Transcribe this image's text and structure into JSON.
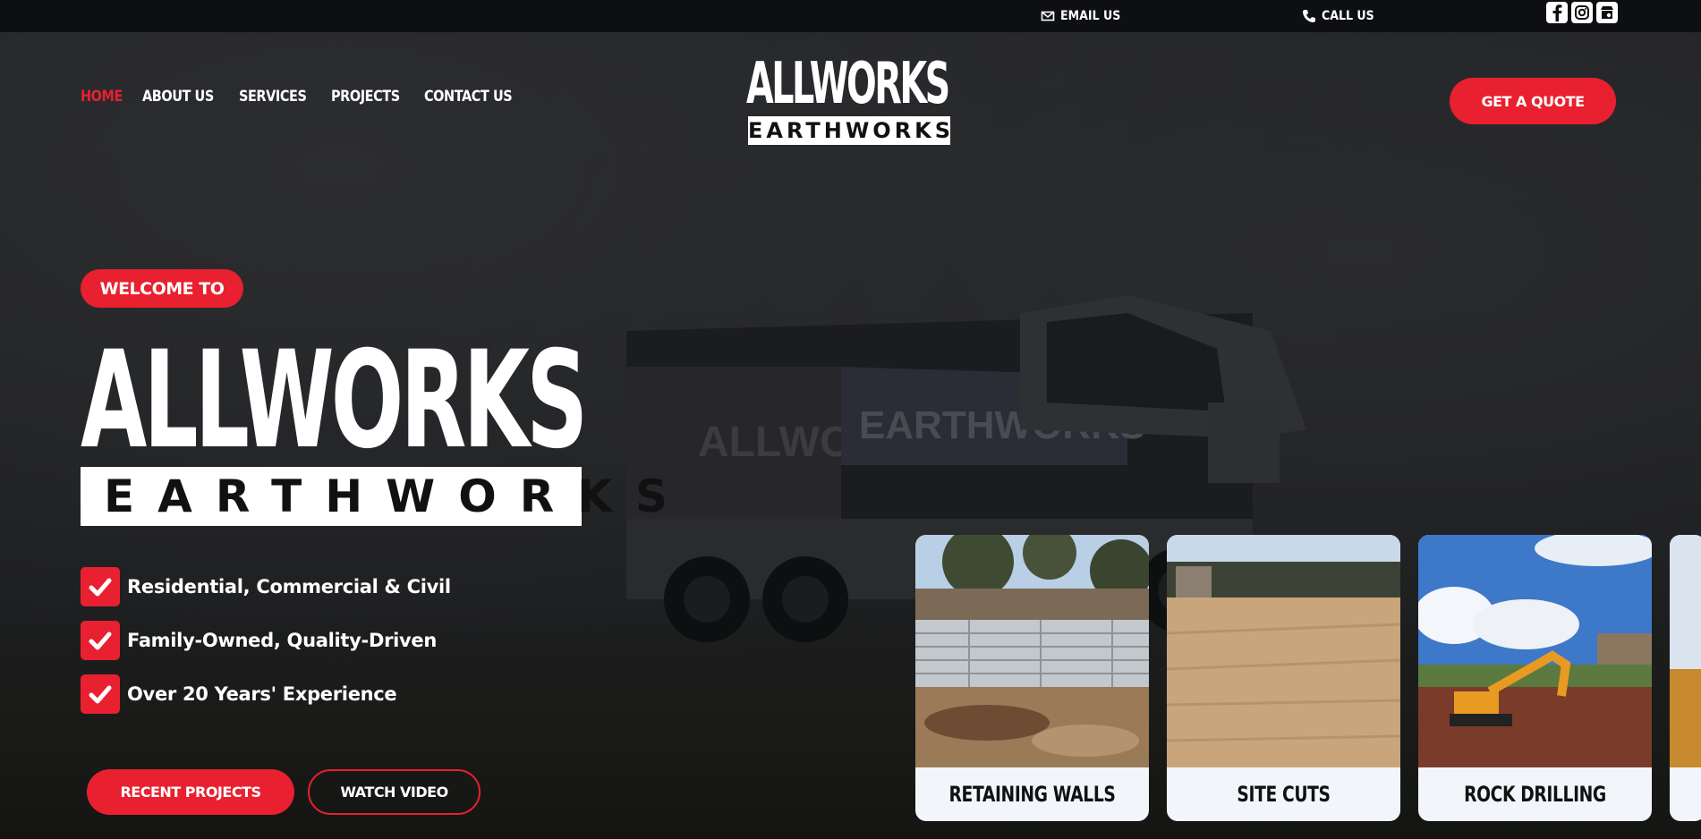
{
  "topbar": {
    "email_label": "EMAIL US",
    "call_label": "CALL US",
    "social": [
      "facebook-icon",
      "instagram-icon",
      "google-business-icon"
    ]
  },
  "nav": {
    "items": [
      {
        "label": "HOME",
        "active": true
      },
      {
        "label": "ABOUT US",
        "active": false
      },
      {
        "label": "SERVICES",
        "active": false
      },
      {
        "label": "PROJECTS",
        "active": false
      },
      {
        "label": "CONTACT US",
        "active": false
      }
    ]
  },
  "logo": {
    "top": "ALLWORKS",
    "bottom": "EARTHWORKS"
  },
  "header": {
    "quote_button": "GET A QUOTE"
  },
  "hero": {
    "badge": "WELCOME TO",
    "title": "ALLWORKS",
    "subtitle": "EARTHWORKS",
    "features": [
      "Residential, Commercial & Civil",
      "Family-Owned, Quality-Driven",
      "Over 20 Years' Experience"
    ],
    "primary_button": "RECENT PROJECTS",
    "secondary_button": "WATCH VIDEO"
  },
  "services": [
    {
      "label": "RETAINING WALLS"
    },
    {
      "label": "SITE CUTS"
    },
    {
      "label": "ROCK DRILLING"
    }
  ],
  "colors": {
    "accent": "#e8202f",
    "topbar": "#0e0f12",
    "card_bg": "#f2f6fa"
  }
}
